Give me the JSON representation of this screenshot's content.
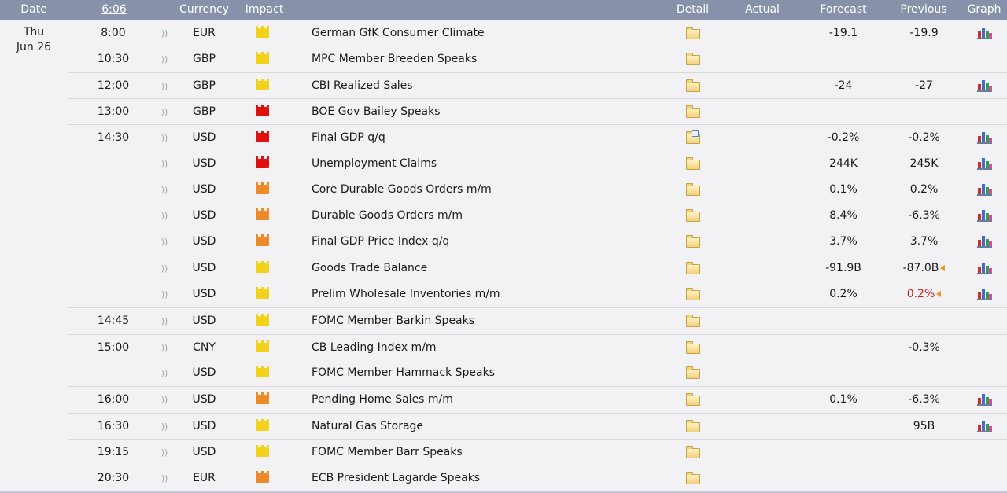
{
  "header": {
    "date": "Date",
    "time": "6:06",
    "currency": "Currency",
    "impact": "Impact",
    "detail": "Detail",
    "actual": "Actual",
    "forecast": "Forecast",
    "previous": "Previous",
    "graph": "Graph"
  },
  "date": {
    "day": "Thu",
    "date": "Jun 26"
  },
  "colors": {
    "high": "#e01010",
    "medium": "#ee8a2a",
    "low": "#f2d21b",
    "header_bg": "#8791a9"
  },
  "events": [
    {
      "time": "8:00",
      "currency": "EUR",
      "impact": "low",
      "title": "German GfK Consumer Climate",
      "forecast": "-19.1",
      "previous": "-19.9",
      "graph": true,
      "sep": true
    },
    {
      "time": "10:30",
      "currency": "GBP",
      "impact": "low",
      "title": "MPC Member Breeden Speaks",
      "forecast": "",
      "previous": "",
      "graph": false,
      "sep": true
    },
    {
      "time": "12:00",
      "currency": "GBP",
      "impact": "low",
      "title": "CBI Realized Sales",
      "forecast": "-24",
      "previous": "-27",
      "graph": true,
      "sep": true
    },
    {
      "time": "13:00",
      "currency": "GBP",
      "impact": "high",
      "title": "BOE Gov Bailey Speaks",
      "forecast": "",
      "previous": "",
      "graph": false,
      "sep": true
    },
    {
      "time": "14:30",
      "currency": "USD",
      "impact": "high",
      "title": "Final GDP q/q",
      "forecast": "-0.2%",
      "previous": "-0.2%",
      "graph": true,
      "sep": true,
      "detail_new": true
    },
    {
      "time": "",
      "currency": "USD",
      "impact": "high",
      "title": "Unemployment Claims",
      "forecast": "244K",
      "previous": "245K",
      "graph": true,
      "sep": false
    },
    {
      "time": "",
      "currency": "USD",
      "impact": "medium",
      "title": "Core Durable Goods Orders m/m",
      "forecast": "0.1%",
      "previous": "0.2%",
      "graph": true,
      "sep": false
    },
    {
      "time": "",
      "currency": "USD",
      "impact": "medium",
      "title": "Durable Goods Orders m/m",
      "forecast": "8.4%",
      "previous": "-6.3%",
      "graph": true,
      "sep": false
    },
    {
      "time": "",
      "currency": "USD",
      "impact": "medium",
      "title": "Final GDP Price Index q/q",
      "forecast": "3.7%",
      "previous": "3.7%",
      "graph": true,
      "sep": false
    },
    {
      "time": "",
      "currency": "USD",
      "impact": "low",
      "title": "Goods Trade Balance",
      "forecast": "-91.9B",
      "previous": "-87.0B",
      "graph": true,
      "sep": false,
      "revised": true
    },
    {
      "time": "",
      "currency": "USD",
      "impact": "low",
      "title": "Prelim Wholesale Inventories m/m",
      "forecast": "0.2%",
      "previous": "0.2%",
      "graph": true,
      "sep": false,
      "revised": true,
      "prev_red": true
    },
    {
      "time": "14:45",
      "currency": "USD",
      "impact": "low",
      "title": "FOMC Member Barkin Speaks",
      "forecast": "",
      "previous": "",
      "graph": false,
      "sep": true
    },
    {
      "time": "15:00",
      "currency": "CNY",
      "impact": "low",
      "title": "CB Leading Index m/m",
      "forecast": "",
      "previous": "-0.3%",
      "graph": false,
      "sep": true
    },
    {
      "time": "",
      "currency": "USD",
      "impact": "low",
      "title": "FOMC Member Hammack Speaks",
      "forecast": "",
      "previous": "",
      "graph": false,
      "sep": false
    },
    {
      "time": "16:00",
      "currency": "USD",
      "impact": "medium",
      "title": "Pending Home Sales m/m",
      "forecast": "0.1%",
      "previous": "-6.3%",
      "graph": true,
      "sep": true
    },
    {
      "time": "16:30",
      "currency": "USD",
      "impact": "low",
      "title": "Natural Gas Storage",
      "forecast": "",
      "previous": "95B",
      "graph": true,
      "sep": true
    },
    {
      "time": "19:15",
      "currency": "USD",
      "impact": "low",
      "title": "FOMC Member Barr Speaks",
      "forecast": "",
      "previous": "",
      "graph": false,
      "sep": true
    },
    {
      "time": "20:30",
      "currency": "EUR",
      "impact": "medium",
      "title": "ECB President Lagarde Speaks",
      "forecast": "",
      "previous": "",
      "graph": false,
      "sep": true
    }
  ]
}
